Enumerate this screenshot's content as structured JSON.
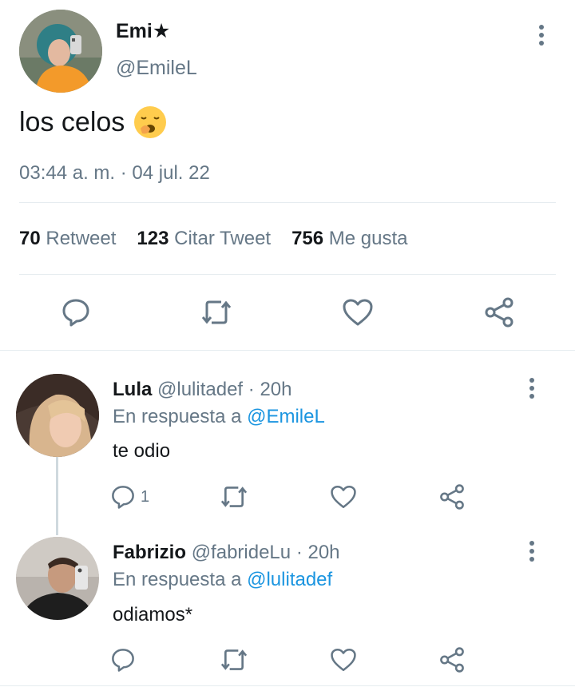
{
  "tweet": {
    "author_name": "Emi★",
    "author_handle": "@EmileL",
    "text": "los celos",
    "emoji": "🥱",
    "timestamp": "03:44 a. m. · 04 jul. 22",
    "stats": {
      "retweets_count": "70",
      "retweets_label": "Retweet",
      "quotes_count": "123",
      "quotes_label": "Citar Tweet",
      "likes_count": "756",
      "likes_label": "Me gusta"
    }
  },
  "replies": [
    {
      "name": "Lula",
      "handle": "@lulitadef",
      "time": "· 20h",
      "reply_prefix": "En respuesta a",
      "reply_to": "@EmileL",
      "text": "te odio",
      "reply_count": "1"
    },
    {
      "name": "Fabrizio",
      "handle": "@fabrideLu",
      "time": "· 20h",
      "reply_prefix": "En respuesta a",
      "reply_to": "@lulitadef",
      "text": "odiamos*",
      "reply_count": ""
    }
  ],
  "colors": {
    "link": "#1b95e0",
    "secondary_text": "#657786",
    "icon": "#657786",
    "divider": "#e6ecf0"
  },
  "icons": [
    "more-vertical-icon",
    "reply-icon",
    "retweet-icon",
    "like-icon",
    "share-icon"
  ]
}
